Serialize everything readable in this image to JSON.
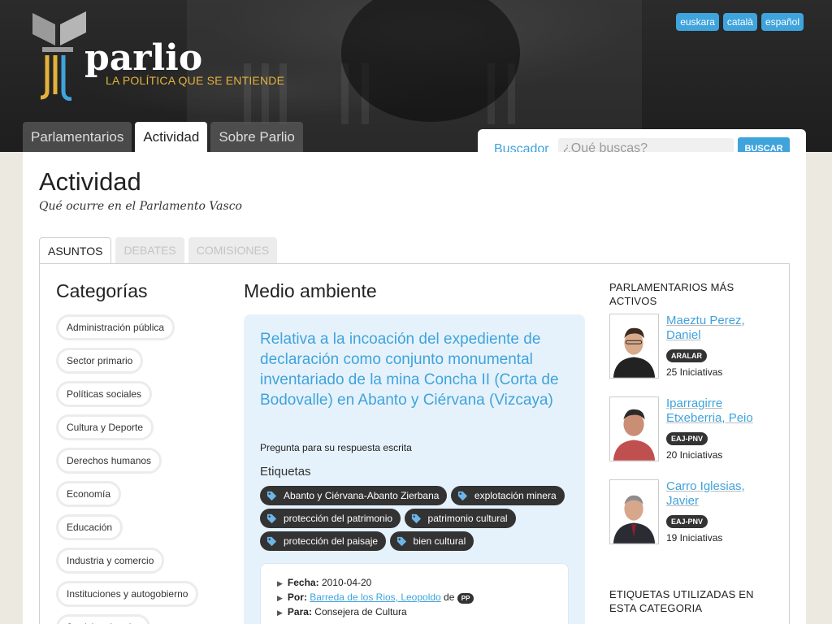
{
  "brand": {
    "wordmark": "parlio",
    "tagline": "LA POLÍTICA QUE SE ENTIENDE"
  },
  "languages": [
    "euskara",
    "català",
    "español"
  ],
  "nav": {
    "tabs": [
      "Parlamentarios",
      "Actividad",
      "Sobre Parlio"
    ],
    "active": "Actividad"
  },
  "search": {
    "label": "Buscador",
    "placeholder": "¿Qué buscas?",
    "button": "BUSCAR"
  },
  "page": {
    "title": "Actividad",
    "subtitle": "Qué ocurre en el Parlamento Vasco"
  },
  "subtabs": [
    "ASUNTOS",
    "DEBATES",
    "COMISIONES"
  ],
  "categories": {
    "title": "Categorías",
    "items": [
      "Administración pública",
      "Sector primario",
      "Políticas sociales",
      "Cultura y Deporte",
      "Derechos humanos",
      "Economía",
      "Educación",
      "Industria y comercio",
      "Instituciones y autogobierno",
      "Justicia e interior"
    ]
  },
  "section": {
    "title": "Medio ambiente",
    "item": {
      "title": "Relativa a la incoación del expediente de declaración como conjunto monumental inventariado de la mina Concha II (Corta de Bodovalle) en Abanto y Ciérvana (Vizcaya)",
      "type": "Pregunta para su respuesta escrita",
      "tags_label": "Etiquetas",
      "tags": [
        "Abanto y Ciérvana-Abanto Zierbana",
        "explotación minera",
        "protección del patrimonio",
        "patrimonio cultural",
        "protección del paisaje",
        "bien cultural"
      ],
      "meta": {
        "fecha_label": "Fecha:",
        "fecha": "2010-04-20",
        "por_label": "Por:",
        "por": "Barreda de los Rios, Leopoldo",
        "por_de": "de",
        "por_party": "PP",
        "para_label": "Para:",
        "para": "Consejera de Cultura"
      }
    }
  },
  "sidebar": {
    "active_title": "PARLAMENTARIOS MÁS ACTIVOS",
    "members": [
      {
        "name": "Maeztu Perez, Daniel",
        "party": "ARALAR",
        "count": "25 Iniciativas"
      },
      {
        "name": "Iparragirre Etxeberria, Peio",
        "party": "EAJ-PNV",
        "count": "20 Iniciativas"
      },
      {
        "name": "Carro Iglesias, Javier",
        "party": "EAJ-PNV",
        "count": "19 Iniciativas"
      }
    ],
    "tags_title": "ETIQUETAS UTILIZADAS EN ESTA CATEGORIA"
  },
  "colors": {
    "accent": "#3fa3dc",
    "tagline": "#e3b23c",
    "dark_badge": "#333333"
  }
}
